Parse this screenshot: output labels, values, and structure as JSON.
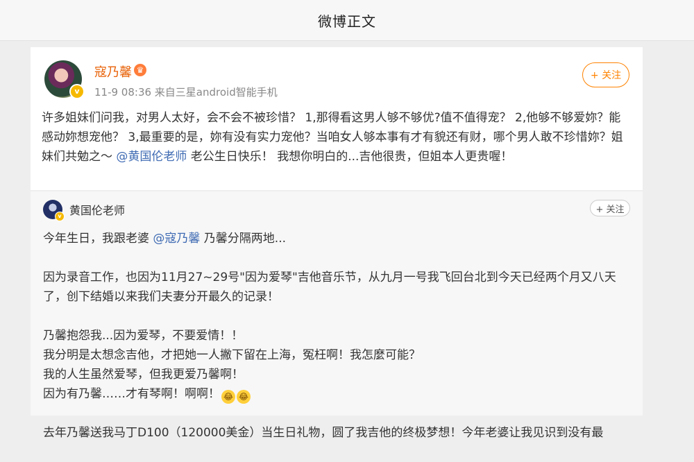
{
  "header": {
    "title": "微博正文"
  },
  "post": {
    "author": "寇乃馨",
    "meta": "11-9 08:36  来自三星android智能手机",
    "follow_label": "+ 关注",
    "text_part1": "许多姐妹们问我，对男人太好，会不会不被珍惜？ 1,那得看这男人够不够优?值不值得宠？ 2,他够不够爱妳？能感动妳想宠他？ 3,最重要的是，妳有没有实力宠他？当咱女人够本事有才有貌还有财，哪个男人敢不珍惜妳？姐妹们共勉之～ ",
    "mention": "@黄国伦老师",
    "text_part2": " 老公生日快乐！ 我想你明白的...吉他很贵，但姐本人更贵喔！"
  },
  "repost": {
    "author": "黄国伦老师",
    "follow_label": "+ 关注",
    "p1_a": "今年生日，我跟老婆 ",
    "p1_mention": "@寇乃馨",
    "p1_b": " 乃馨分隔两地...",
    "p2": "因为录音工作，也因为11月27~29号\"因为爱琴\"吉他音乐节，从九月一号我飞回台北到今天已经两个月又八天了，创下结婚以来我们夫妻分开最久的记录！",
    "p3_l1": "乃馨抱怨我...因为爱琴，不要爱情！！",
    "p3_l2": "我分明是太想念吉他，才把她一人撇下留在上海，冤枉啊！我怎麼可能？",
    "p3_l3": "我的人生虽然爱琴，但我更爱乃馨啊！",
    "p3_l4": "因为有乃馨……才有琴啊！啊啊！",
    "p4": "去年乃馨送我马丁D100（120000美金）当生日礼物，圆了我吉他的终极梦想！今年老婆让我见识到没有最"
  }
}
